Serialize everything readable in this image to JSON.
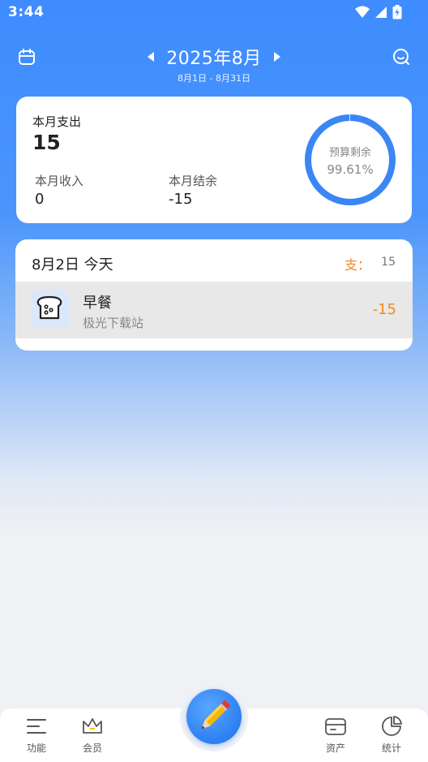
{
  "status_bar": {
    "time": "3:44"
  },
  "header": {
    "month_title": "2025年8月",
    "date_range": "8月1日 - 8月31日"
  },
  "summary": {
    "expense_label": "本月支出",
    "expense_value": "15",
    "income_label": "本月收入",
    "income_value": "0",
    "balance_label": "本月结余",
    "balance_value": "-15",
    "budget_label": "预算剩余",
    "budget_value": "99.61%",
    "budget_remaining_fraction": 0.9961
  },
  "day_group": {
    "title": "8月2日 今天",
    "expense_label": "支：",
    "expense_value": "15",
    "transactions": [
      {
        "icon": "bread-icon",
        "title": "早餐",
        "note": "极光下载站",
        "amount": "-15"
      }
    ]
  },
  "bottom_nav": {
    "tabs": [
      {
        "label": "功能",
        "icon": "menu-icon"
      },
      {
        "label": "会员",
        "icon": "crown-icon"
      },
      {
        "label": "资产",
        "icon": "card-icon"
      },
      {
        "label": "统计",
        "icon": "pie-chart-icon"
      }
    ],
    "fab_icon": "pencil-icon"
  },
  "colors": {
    "primary": "#3e8cff",
    "accent_orange": "#f08a22",
    "ring": "#3a86f5"
  }
}
